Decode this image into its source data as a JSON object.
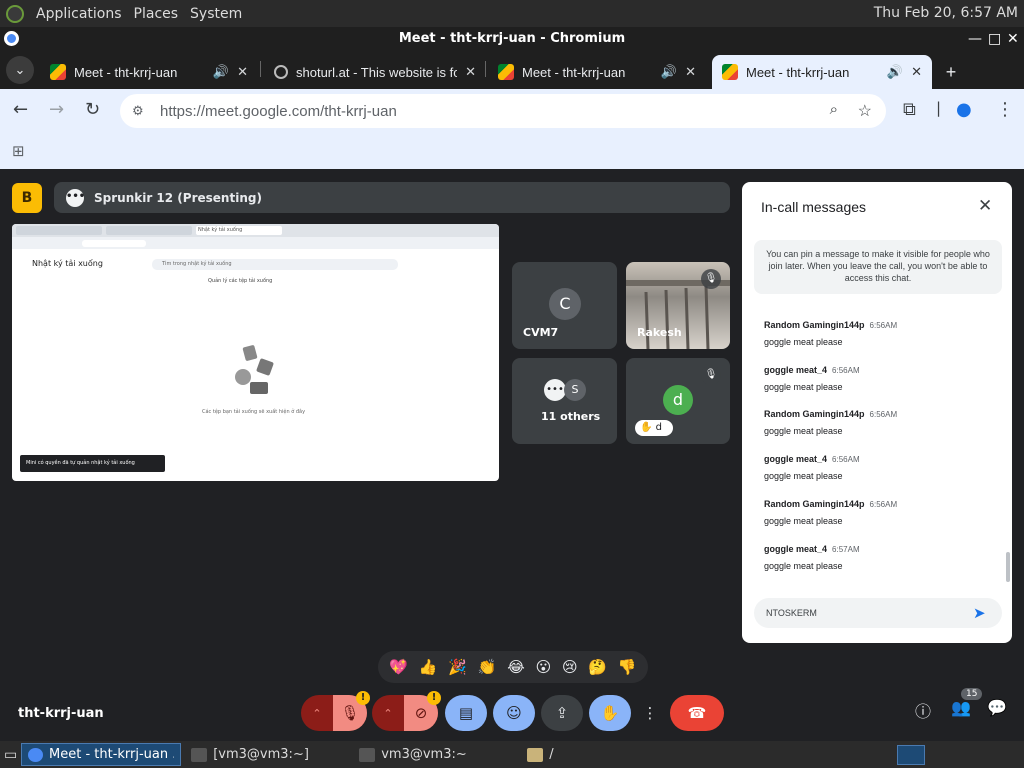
{
  "os": {
    "menu": [
      "Applications",
      "Places",
      "System"
    ],
    "clock": "Thu Feb 20,  6:57 AM"
  },
  "window": {
    "title": "Meet - tht-krrj-uan - Chromium"
  },
  "tabs": [
    {
      "title": "Meet - tht-krrj-uan",
      "icon": "meet-icon",
      "audio": true
    },
    {
      "title": "shoturl.at - This website is for sale",
      "icon": "globe-icon",
      "audio": false
    },
    {
      "title": "Meet - tht-krrj-uan",
      "icon": "meet-icon",
      "audio": true
    },
    {
      "title": "Meet - tht-krrj-uan",
      "icon": "meet-icon",
      "audio": true,
      "active": true
    }
  ],
  "address": {
    "host": "https://meet.google.com/",
    "path": "tht-krrj-uan"
  },
  "meet": {
    "logo_letter": "B",
    "presenter": "Sprunkir 12 (Presenting)",
    "presentation": {
      "page_title": "Nhật ký tải xuống",
      "search_placeholder": "Tìm trong nhật ký tải xuống",
      "note": "Quản lý các tệp tải xuống",
      "empty_message": "Các tệp bạn tải xuống sẽ xuất hiện ở đây",
      "toast": "Mini có quyền đã tự quản nhật ký tải xuống"
    },
    "tiles": [
      {
        "name": "CVM7",
        "initial": "C",
        "muted": false
      },
      {
        "name": "Rakesh",
        "initial": "",
        "muted": true,
        "video": true
      },
      {
        "name": "11 others",
        "initial": "S",
        "muted": false
      },
      {
        "name": "d",
        "initial": "d",
        "muted": true
      }
    ],
    "chat": {
      "title": "In-call messages",
      "pin_note": "You can pin a message to make it visible for people who join later. When you leave the call, you won't be able to access this chat.",
      "messages": [
        {
          "sender": "Random Gamingin144p",
          "time": "6:56AM",
          "text": "goggle meat please"
        },
        {
          "sender": "goggle meat_4",
          "time": "6:56AM",
          "text": "goggle meat please"
        },
        {
          "sender": "Random Gamingin144p",
          "time": "6:56AM",
          "text": "goggle meat please"
        },
        {
          "sender": "goggle meat_4",
          "time": "6:56AM",
          "text": "goggle meat please"
        },
        {
          "sender": "Random Gamingin144p",
          "time": "6:56AM",
          "text": "goggle meat please"
        },
        {
          "sender": "goggle meat_4",
          "time": "6:57AM",
          "text": "goggle meat please"
        }
      ],
      "input_value": "NTOSKERM"
    },
    "reactions": [
      "💖",
      "👍",
      "🎉",
      "👏",
      "😂",
      "😮",
      "😢",
      "🤔",
      "👎"
    ],
    "meeting_code": "tht-krrj-uan",
    "people_count": "15"
  },
  "taskbar": [
    {
      "label": "Meet - tht-krrj-uan ...",
      "active": true
    },
    {
      "label": "[vm3@vm3:~]",
      "active": false
    },
    {
      "label": "vm3@vm3:~",
      "active": false
    },
    {
      "label": "/",
      "active": false
    }
  ],
  "colors": {
    "meet_bg": "#202124",
    "tile_bg": "#3c4043",
    "accent_blue": "#8ab4f8",
    "end_call_red": "#ea4335",
    "muted_red": "#8c1d18"
  }
}
